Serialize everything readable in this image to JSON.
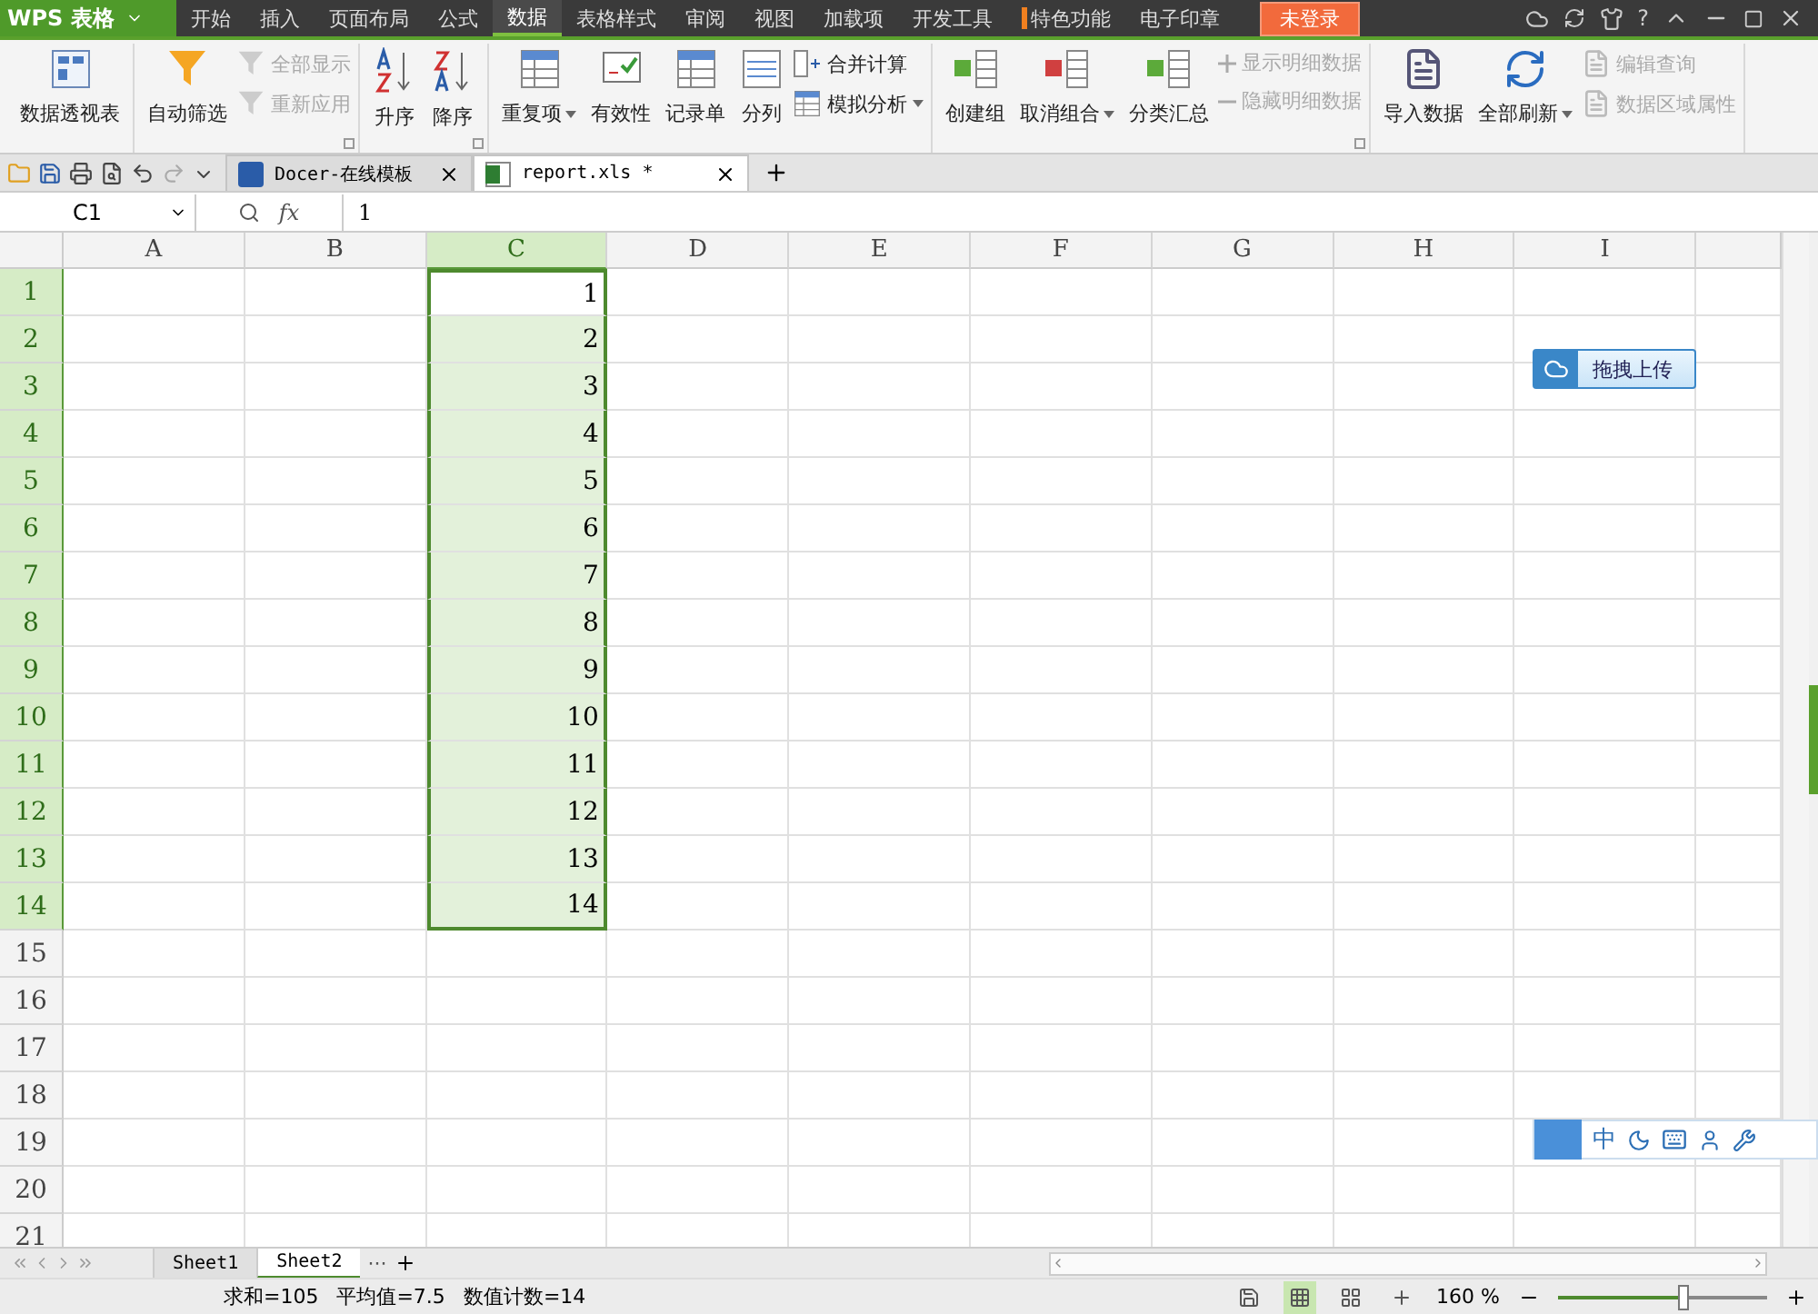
{
  "app": {
    "logo": "WPS 表格"
  },
  "menu": [
    {
      "label": "开始",
      "selected": false
    },
    {
      "label": "插入",
      "selected": false
    },
    {
      "label": "页面布局",
      "selected": false
    },
    {
      "label": "公式",
      "selected": false
    },
    {
      "label": "数据",
      "selected": true
    },
    {
      "label": "表格样式",
      "selected": false
    },
    {
      "label": "审阅",
      "selected": false
    },
    {
      "label": "视图",
      "selected": false
    },
    {
      "label": "加载项",
      "selected": false
    },
    {
      "label": "开发工具",
      "selected": false
    },
    {
      "label": "特色功能",
      "selected": false,
      "marked": true
    },
    {
      "label": "电子印章",
      "selected": false
    }
  ],
  "login": "未登录",
  "help": "?",
  "ribbon": [
    {
      "items": [
        {
          "kind": "large",
          "label": "数据透视表"
        }
      ]
    },
    {
      "items": [
        {
          "kind": "large",
          "label": "自动筛选"
        },
        {
          "kind": "stack",
          "buttons": [
            {
              "label": "全部显示",
              "disabled": true
            },
            {
              "label": "重新应用",
              "disabled": true
            }
          ]
        },
        {
          "kind": "launcher"
        }
      ]
    },
    {
      "items": [
        {
          "kind": "large",
          "label": "升序"
        },
        {
          "kind": "large",
          "label": "降序"
        },
        {
          "kind": "launcher"
        }
      ]
    },
    {
      "items": [
        {
          "kind": "large",
          "label": "重复项",
          "dropdown": true
        },
        {
          "kind": "large",
          "label": "有效性"
        },
        {
          "kind": "large",
          "label": "记录单"
        },
        {
          "kind": "large",
          "label": "分列"
        },
        {
          "kind": "stack",
          "buttons": [
            {
              "label": "合并计算",
              "disabled": false
            },
            {
              "label": "模拟分析",
              "disabled": false,
              "dropdown": true
            }
          ]
        }
      ]
    },
    {
      "items": [
        {
          "kind": "large",
          "label": "创建组"
        },
        {
          "kind": "large",
          "label": "取消组合",
          "dropdown": true
        },
        {
          "kind": "large",
          "label": "分类汇总"
        },
        {
          "kind": "stack",
          "buttons": [
            {
              "label": "显示明细数据",
              "disabled": true
            },
            {
              "label": "隐藏明细数据",
              "disabled": true
            }
          ]
        },
        {
          "kind": "launcher"
        }
      ]
    },
    {
      "items": [
        {
          "kind": "large",
          "label": "导入数据"
        },
        {
          "kind": "large",
          "label": "全部刷新",
          "dropdown": true
        },
        {
          "kind": "stack",
          "buttons": [
            {
              "label": "编辑查询",
              "disabled": true
            },
            {
              "label": "数据区域属性",
              "disabled": true
            }
          ]
        }
      ]
    }
  ],
  "doc_tabs": [
    {
      "label": "Docer-在线模板",
      "kind": "docer",
      "selected": false
    },
    {
      "label": "report.xls *",
      "kind": "sheet",
      "selected": true
    }
  ],
  "formula_bar": {
    "name_box": "C1",
    "fx": "fx",
    "value": "1"
  },
  "grid": {
    "columns": [
      {
        "label": "A",
        "selected": false
      },
      {
        "label": "B",
        "selected": false
      },
      {
        "label": "C",
        "selected": true,
        "cells": [
          "1",
          "2",
          "3",
          "4",
          "5",
          "6",
          "7",
          "8",
          "9",
          "10",
          "11",
          "12",
          "13",
          "14"
        ]
      },
      {
        "label": "D",
        "selected": false
      },
      {
        "label": "E",
        "selected": false
      },
      {
        "label": "F",
        "selected": false
      },
      {
        "label": "G",
        "selected": false
      },
      {
        "label": "H",
        "selected": false
      },
      {
        "label": "I",
        "selected": false
      }
    ],
    "rows": [
      {
        "label": "1",
        "selected": true
      },
      {
        "label": "2",
        "selected": true
      },
      {
        "label": "3",
        "selected": true
      },
      {
        "label": "4",
        "selected": true
      },
      {
        "label": "5",
        "selected": true
      },
      {
        "label": "6",
        "selected": true
      },
      {
        "label": "7",
        "selected": true
      },
      {
        "label": "8",
        "selected": true
      },
      {
        "label": "9",
        "selected": true
      },
      {
        "label": "10",
        "selected": true
      },
      {
        "label": "11",
        "selected": true
      },
      {
        "label": "12",
        "selected": true
      },
      {
        "label": "13",
        "selected": true
      },
      {
        "label": "14",
        "selected": true
      },
      {
        "label": "15",
        "selected": false
      },
      {
        "label": "16",
        "selected": false
      },
      {
        "label": "17",
        "selected": false
      },
      {
        "label": "18",
        "selected": false
      },
      {
        "label": "19",
        "selected": false
      },
      {
        "label": "20",
        "selected": false
      },
      {
        "label": "21",
        "selected": false
      }
    ]
  },
  "upload_button": "拖拽上传",
  "ime": {
    "mode": "中"
  },
  "sheet_tabs": [
    {
      "label": "Sheet1",
      "selected": false
    },
    {
      "label": "Sheet2",
      "selected": true
    }
  ],
  "sheet_more": "···",
  "status": {
    "sum": "求和=105",
    "average": "平均值=7.5",
    "count": "数值计数=14",
    "zoom": "160 %",
    "zoom_level": {
      "level": 0.6
    }
  }
}
